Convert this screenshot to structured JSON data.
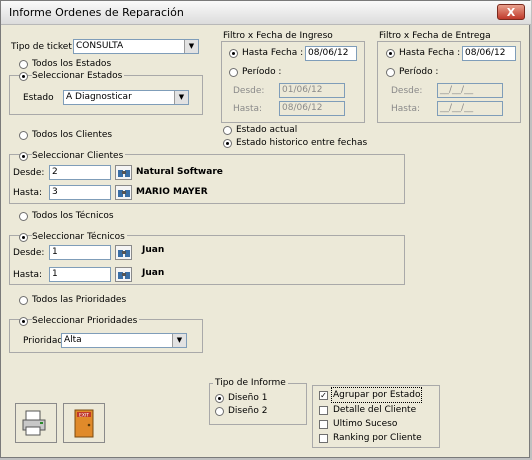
{
  "window": {
    "title": "Informe Ordenes de Reparación",
    "close_label": "X"
  },
  "ticket": {
    "label": "Tipo de ticket",
    "value": "CONSULTA"
  },
  "estados": {
    "todos_label": "Todos los Estados",
    "seleccionar_label": "Seleccionar Estados",
    "estado_label": "Estado",
    "estado_value": "A Diagnosticar",
    "selected": "seleccionar"
  },
  "ingreso": {
    "group_label": "Filtro x Fecha de Ingreso",
    "hasta_fecha_label": "Hasta Fecha :",
    "hasta_fecha_value": "08/06/12",
    "periodo_label": "Período :",
    "desde_label": "Desde:",
    "desde_value": "01/06/12",
    "hasta_label": "Hasta:",
    "hasta_value": "08/06/12"
  },
  "entrega": {
    "group_label": "Filtro x Fecha de Entrega",
    "hasta_fecha_label": "Hasta Fecha :",
    "hasta_fecha_value": "08/06/12",
    "periodo_label": "Período :",
    "desde_label": "Desde:",
    "desde_value": "__/__/__",
    "hasta_label": "Hasta:",
    "hasta_value": "__/__/__"
  },
  "estado_modo": {
    "actual_label": "Estado actual",
    "historico_label": "Estado historico entre fechas",
    "selected": "historico"
  },
  "clientes": {
    "todos_label": "Todos los Clientes",
    "seleccionar_label": "Seleccionar Clientes",
    "desde_label": "Desde:",
    "desde_value": "2",
    "desde_name": "Natural Software",
    "hasta_label": "Hasta:",
    "hasta_value": "3",
    "hasta_name": "MARIO MAYER"
  },
  "tecnicos": {
    "todos_label": "Todos los Técnicos",
    "seleccionar_label": "Seleccionar Técnicos",
    "desde_label": "Desde:",
    "desde_value": "1",
    "desde_name": "Juan",
    "hasta_label": "Hasta:",
    "hasta_value": "1",
    "hasta_name": "Juan"
  },
  "prioridades": {
    "todos_label": "Todos las Prioridades",
    "seleccionar_label": "Seleccionar Prioridades",
    "prioridad_label": "Prioridad",
    "prioridad_value": "Alta"
  },
  "tipo_informe": {
    "group_label": "Tipo de Informe",
    "diseno1_label": "Diseño 1",
    "diseno2_label": "Diseño 2",
    "selected": "diseno1"
  },
  "opciones": {
    "agrupar_label": "Agrupar por Estado",
    "detalle_label": "Detalle del Cliente",
    "ultimo_label": "Ultimo Suceso",
    "ranking_label": "Ranking por Cliente",
    "agrupar_checked": true,
    "detalle_checked": false,
    "ultimo_checked": false,
    "ranking_checked": false
  },
  "buttons": {
    "print_icon": "printer-icon",
    "exit_icon": "exit-door-icon",
    "exit_text": "EXIT"
  },
  "colors": {
    "window_bg": "#ece9d8",
    "close_red": "#c0392b",
    "input_border": "#7f9db9"
  }
}
